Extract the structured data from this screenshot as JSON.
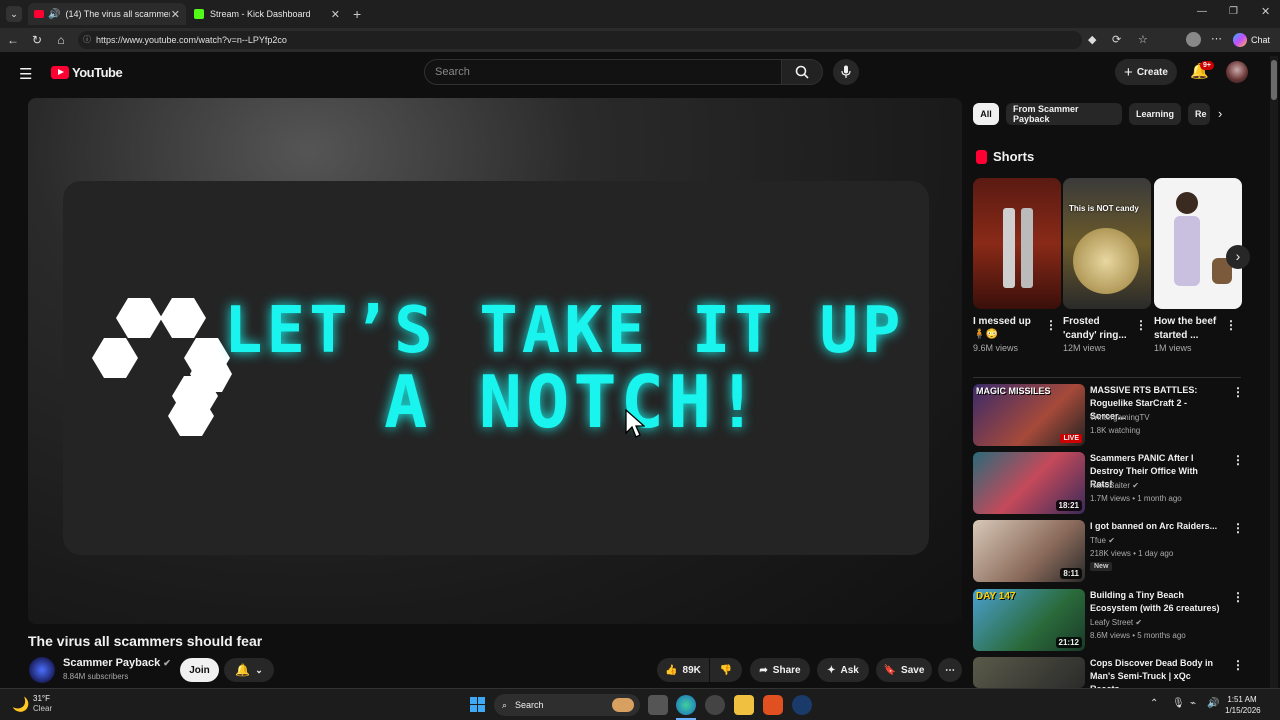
{
  "browser": {
    "tabs": [
      {
        "label": "(14) The virus all scammers sh"
      },
      {
        "label": "Stream - Kick Dashboard"
      }
    ],
    "url": "https://www.youtube.com/watch?v=n--LPYfp2co",
    "chat_label": "Chat"
  },
  "header": {
    "logo": "YouTube",
    "search_placeholder": "Search",
    "create_label": "Create",
    "notif_badge": "9+"
  },
  "video": {
    "overlay_line1": "LET’S TAKE IT UP",
    "overlay_line2": "A NOTCH!",
    "title": "The virus all scammers should fear",
    "channel": "Scammer Payback",
    "subscribers": "8.84M subscribers",
    "join_label": "Join",
    "likes": "89K",
    "share_label": "Share",
    "ask_label": "Ask",
    "save_label": "Save"
  },
  "chips": [
    "All",
    "From Scammer Payback",
    "Learning",
    "Re"
  ],
  "shorts": {
    "heading": "Shorts",
    "items": [
      {
        "title_line1": "I messed up",
        "title_line2": "",
        "views": "9.6M views"
      },
      {
        "title_line1": "Frosted",
        "title_line2": "'candy' ring...",
        "views": "12M views"
      },
      {
        "title_line1": "How the beef",
        "title_line2": "started ...",
        "views": "1M views"
      }
    ],
    "short2_overlay": "This is NOT candy"
  },
  "recommendations": [
    {
      "title": "MASSIVE RTS BATTLES: Roguelike StarCraft 2 - Sorcer...",
      "channel": "WintergamingTV",
      "meta": "1.8K watching",
      "badge": "LIVE",
      "thumb_text": "MAGIC MISSILES"
    },
    {
      "title": "Scammers PANIC After I Destroy Their Office With Rats!",
      "channel": "NanoBaiter",
      "meta": "1.7M views • 1 month ago",
      "duration": "18:21"
    },
    {
      "title": "I got banned on Arc Raiders...",
      "channel": "Tfue",
      "meta": "218K views • 1 day ago",
      "tag": "New",
      "duration": "8:11"
    },
    {
      "title": "Building a Tiny Beach Ecosystem (with 26 creatures)",
      "channel": "Leafy Street",
      "meta": "8.6M views • 5 months ago",
      "duration": "21:12",
      "thumb_text": "DAY 147"
    },
    {
      "title": "Cops Discover Dead Body in Man's Semi-Truck | xQc Reacts",
      "channel": "",
      "meta": ""
    }
  ],
  "taskbar": {
    "temp": "31°F",
    "weather": "Clear",
    "search_label": "Search",
    "time": "1:51 AM",
    "date": "1/15/2026"
  },
  "colors": {
    "accent": "#19f4ee",
    "yt_red": "#ff0033",
    "live_red": "#cc0000"
  }
}
